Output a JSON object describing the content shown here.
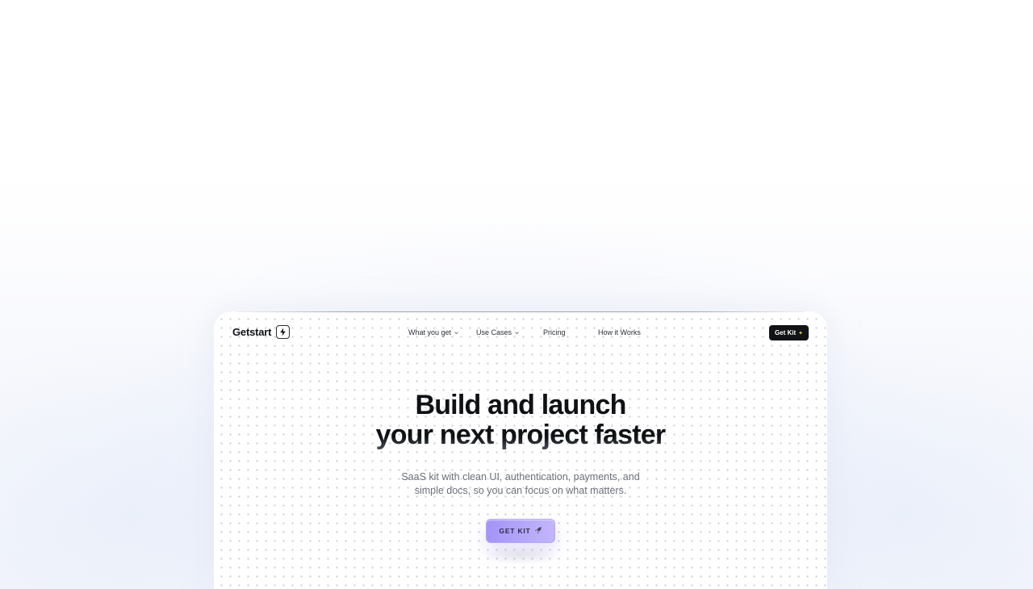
{
  "brand": {
    "name": "Getstart",
    "logo_icon": "lightning-bolt-icon"
  },
  "nav": {
    "items": [
      {
        "label": "What you get",
        "has_dropdown": true
      },
      {
        "label": "Use Cases",
        "has_dropdown": true
      },
      {
        "label": "Pricing",
        "has_dropdown": false
      },
      {
        "label": "How it Works",
        "has_dropdown": false
      }
    ],
    "cta_label": "Get Kit",
    "cta_icon": "sparkle-icon"
  },
  "hero": {
    "title_line1": "Build and launch",
    "title_line2": "your next project faster",
    "subtitle_line1": "SaaS kit with clean UI, authentication, payments, and",
    "subtitle_line2": "simple docs, so you can focus on what matters.",
    "cta_label": "GET KIT",
    "cta_icon": "rocket-icon"
  },
  "colors": {
    "cta_dark": "#121316",
    "cta_purple_start": "#a394f7",
    "cta_purple_end": "#c3b6fb",
    "title": "#0f1115",
    "subtitle": "#6b7079"
  }
}
